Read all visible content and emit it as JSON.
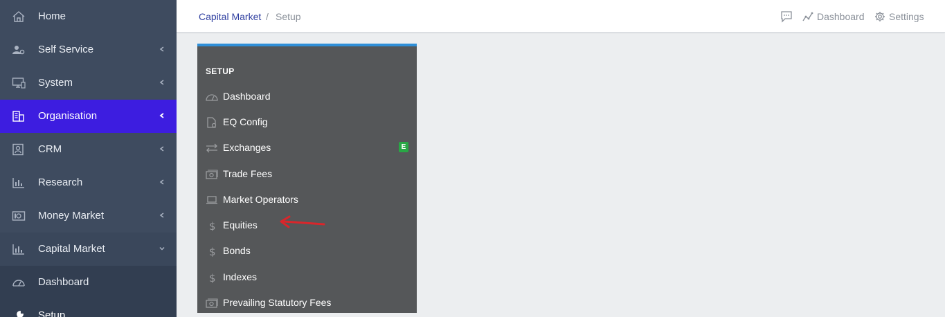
{
  "sidebar": {
    "items": [
      {
        "label": "Home"
      },
      {
        "label": "Self Service"
      },
      {
        "label": "System"
      },
      {
        "label": "Organisation"
      },
      {
        "label": "CRM"
      },
      {
        "label": "Research"
      },
      {
        "label": "Money Market"
      },
      {
        "label": "Capital Market"
      },
      {
        "label": "Dashboard"
      },
      {
        "label": "Setup"
      }
    ]
  },
  "header": {
    "breadcrumb": {
      "parent": "Capital Market",
      "separator": "/",
      "current": "Setup"
    },
    "dashboard_label": "Dashboard",
    "settings_label": "Settings"
  },
  "panel": {
    "title": "SETUP",
    "items": [
      {
        "label": "Dashboard",
        "icon": "gauge-icon"
      },
      {
        "label": "EQ Config",
        "icon": "file-gear-icon"
      },
      {
        "label": "Exchanges",
        "icon": "exchange-arrows-icon",
        "badge": "E"
      },
      {
        "label": "Trade Fees",
        "icon": "money-icon"
      },
      {
        "label": "Market Operators",
        "icon": "laptop-icon"
      },
      {
        "label": "Equities",
        "icon": "dollar-icon"
      },
      {
        "label": "Bonds",
        "icon": "dollar-icon"
      },
      {
        "label": "Indexes",
        "icon": "dollar-icon"
      },
      {
        "label": "Prevailing Statutory Fees",
        "icon": "money-icon"
      }
    ]
  },
  "colors": {
    "sidebar_bg": "#3e4b5f",
    "sidebar_active": "#3d1de0",
    "panel_bg": "#555759",
    "panel_accent": "#2f8fd8",
    "badge_green": "#28a745",
    "annotation_arrow": "#d9262b",
    "breadcrumb_link": "#2f3fa0"
  }
}
